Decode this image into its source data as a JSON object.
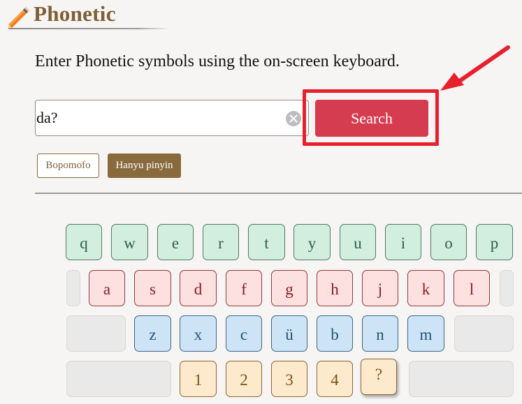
{
  "header": {
    "title": "Phonetic",
    "icon": "pencil-icon"
  },
  "instruction": "Enter Phonetic symbols using the on-screen keyboard.",
  "search": {
    "value": "da?",
    "placeholder": "",
    "clear_icon": "clear-circle-x-icon",
    "button_label": "Search"
  },
  "modes": {
    "bopomofo_label": "Bopomofo",
    "pinyin_label": "Hanyu pinyin",
    "active": "Hanyu pinyin"
  },
  "annotation": {
    "highlight_color": "#e8202e",
    "target": "Search"
  },
  "keyboard": {
    "row1": [
      "q",
      "w",
      "e",
      "r",
      "t",
      "y",
      "u",
      "i",
      "o",
      "p"
    ],
    "row2": [
      "a",
      "s",
      "d",
      "f",
      "g",
      "h",
      "j",
      "k",
      "l"
    ],
    "row3": [
      "z",
      "x",
      "c",
      "ü",
      "b",
      "n",
      "m"
    ],
    "row4": [
      "1",
      "2",
      "3",
      "4",
      "?"
    ]
  },
  "colors": {
    "accent": "#d63c50",
    "brand": "#7e5f36",
    "row1": "#d2eedf",
    "row2": "#fde0e0",
    "row3": "#cde4f6",
    "row4": "#fde9cc"
  }
}
